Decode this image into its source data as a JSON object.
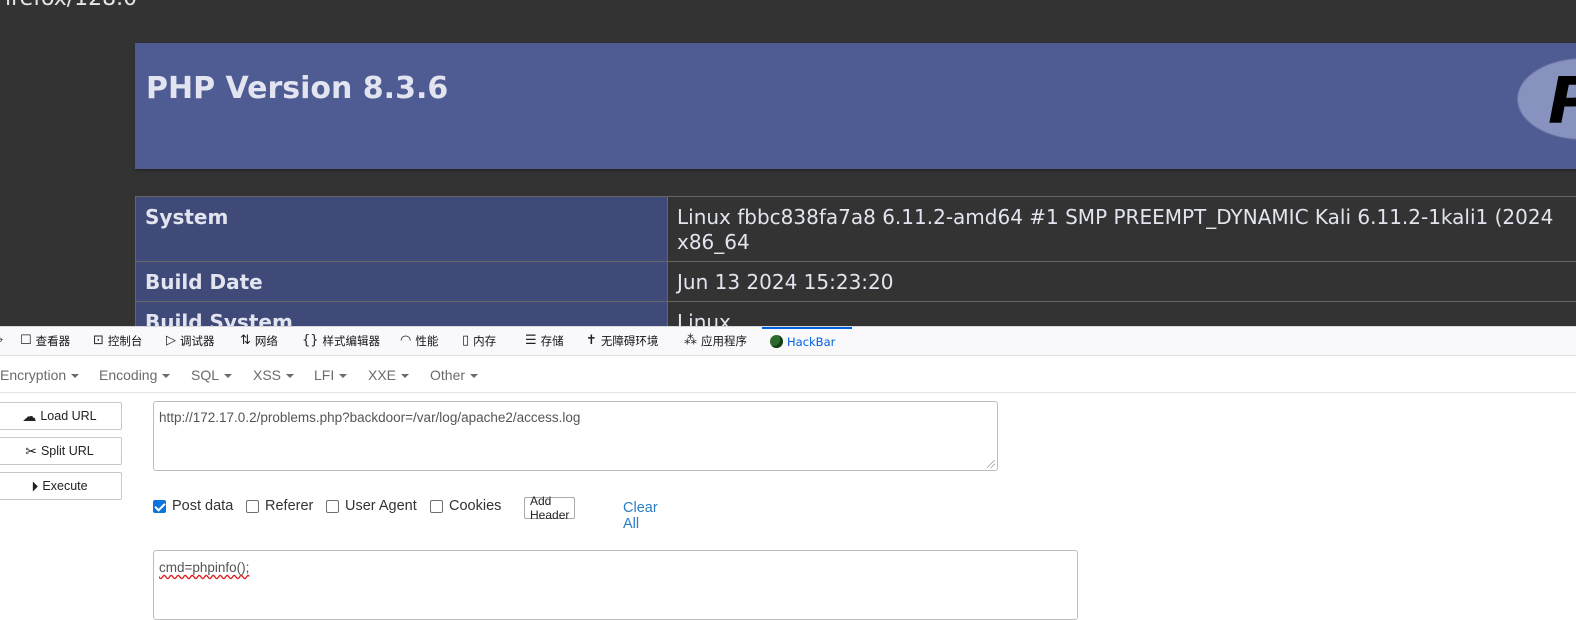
{
  "page": {
    "user_agent_fragment": "irefox/128.0",
    "php_title": "PHP Version 8.3.6",
    "php_logo_letter": "P",
    "info_rows": [
      {
        "key": "System",
        "value": "Linux fbbc838fa7a8 6.11.2-amd64 #1 SMP PREEMPT_DYNAMIC Kali 6.11.2-1kali1 (2024",
        "value2": "x86_64"
      },
      {
        "key": "Build Date",
        "value": "Jun 13 2024 15:23:20"
      },
      {
        "key": "Build System",
        "value": "Linux"
      }
    ]
  },
  "devtools": {
    "tabs": [
      {
        "label": "查看器",
        "icon": "inspector-icon"
      },
      {
        "label": "控制台",
        "icon": "console-icon"
      },
      {
        "label": "调试器",
        "icon": "debugger-icon"
      },
      {
        "label": "网络",
        "icon": "network-icon"
      },
      {
        "label": "样式编辑器",
        "icon": "style-editor-icon"
      },
      {
        "label": "性能",
        "icon": "performance-icon"
      },
      {
        "label": "内存",
        "icon": "memory-icon"
      },
      {
        "label": "存储",
        "icon": "storage-icon"
      },
      {
        "label": "无障碍环境",
        "icon": "accessibility-icon"
      },
      {
        "label": "应用程序",
        "icon": "application-icon"
      },
      {
        "label": "HackBar",
        "icon": "hackbar-icon"
      }
    ],
    "active_tab": "HackBar"
  },
  "hackbar": {
    "menu": [
      "Encryption",
      "Encoding",
      "SQL",
      "XSS",
      "LFI",
      "XXE",
      "Other"
    ],
    "buttons": {
      "load_url": "Load URL",
      "split_url": "Split URL",
      "execute": "Execute"
    },
    "url_value": "http://172.17.0.2/problems.php?backdoor=/var/log/apache2/access.log",
    "options": [
      {
        "label": "Post data",
        "checked": true
      },
      {
        "label": "Referer",
        "checked": false
      },
      {
        "label": "User Agent",
        "checked": false
      },
      {
        "label": "Cookies",
        "checked": false
      }
    ],
    "add_header_label": "Add Header",
    "clear_all_label": "Clear All",
    "post_data_value": "cmd=phpinfo();"
  },
  "colors": {
    "page_bg": "#333333",
    "php_header": "#4f5b93",
    "table_key_bg": "#3f4a79",
    "active_tab": "#0061e0",
    "link": "#2a7ec9",
    "checkbox_checked": "#0b74de"
  }
}
